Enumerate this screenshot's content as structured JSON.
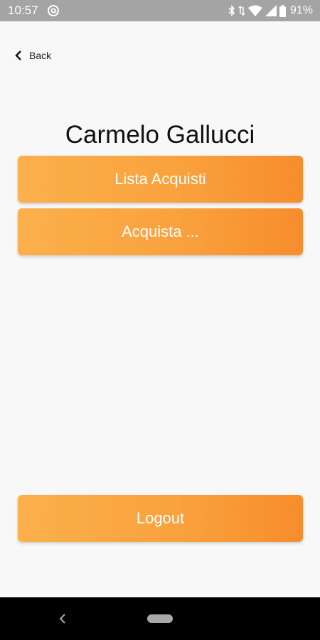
{
  "status_bar": {
    "time": "10:57",
    "battery": "91%",
    "icons": [
      "at-sign-icon",
      "bluetooth-icon",
      "data-arrows-icon",
      "wifi-icon",
      "signal-icon",
      "battery-icon"
    ]
  },
  "header": {
    "back_label": "Back",
    "back_icon": "chevron-left-icon"
  },
  "profile": {
    "name": "Carmelo Gallucci"
  },
  "buttons": {
    "lista_acquisti": "Lista Acquisti",
    "acquista": "Acquista ...",
    "logout": "Logout"
  },
  "colors": {
    "status_bar": "#a4a4a4",
    "background": "#f8f8f8",
    "button_start": "#fbb04b",
    "button_end": "#f78d2c",
    "button_text": "#ffffff",
    "nav_bar": "#000000"
  },
  "nav_bar": {
    "icons": [
      "back-triangle-icon",
      "home-pill-icon"
    ]
  }
}
